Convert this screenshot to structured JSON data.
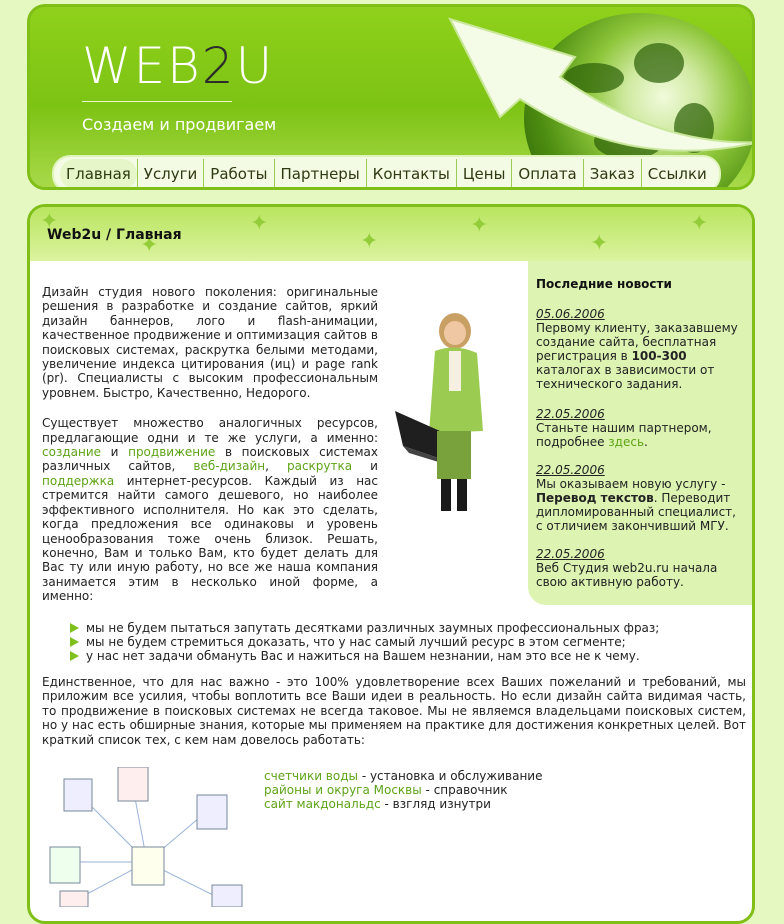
{
  "header": {
    "logo_left": "WEB",
    "logo_two": "2",
    "logo_right": "U",
    "slogan": "Создаем и продвигаем"
  },
  "nav": {
    "items": [
      "Главная",
      "Услуги",
      "Работы",
      "Партнеры",
      "Контакты",
      "Цены",
      "Оплата",
      "Заказ",
      "Ссылки"
    ],
    "active": 0
  },
  "breadcrumb": "Web2u / Главная",
  "intro": "Дизайн студия нового поколения: оригинальные решения в разработке и создание сайтов, яркий дизайн баннеров, лого и flash-анимации, качественное продвижение и оптимизация сайтов в поисковых системах, раскрутка белыми методами, увеличение индекса цитирования (иц) и page rank (pr). Специалисты с высоким профессиональным уровнем. Быстро, Качественно, Недорого.",
  "para2": {
    "before": "Существует множество аналогичных ресурсов, предлагающие одни и те же услуги, а именно: ",
    "link1": "создание",
    "and1": " и ",
    "link2": "продвижение",
    "mid": " в поисковых системах различных сайтов, ",
    "link3": "веб-дизайн",
    "comma": ", ",
    "link4": "раскрутка",
    "and2": " и ",
    "link5": "поддержка",
    "after": " интернет-ресурсов. Каждый из нас стремится найти самого дешевого, но наиболее эффективного исполнителя. Но как это сделать, когда предложения все одинаковы и уровень ценообразования тоже очень близок. Решать, конечно, Вам и только Вам, кто будет делать для Вас ту или иную работу, но все же наша компания занимается этим в несколько иной форме, а именно:"
  },
  "bullets": [
    "мы не будем пытаться запутать десятками различных заумных профессиональных фраз;",
    "мы не будем стремиться доказать, что у нас самый лучший ресурс в этом сегменте;",
    "у нас нет задачи обмануть Вас и нажиться на Вашем незнании, нам это все не к чему."
  ],
  "bottom_para": "Единственное, что для нас важно - это 100% удовлетворение всех Ваших пожеланий и требований, мы приложим все усилия, чтобы воплотить все Ваши идеи в реальность. Но если дизайн сайта видимая часть, то продвижение в поисковых системах не всегда таковое. Мы не являемся владельцами поисковых систем, но у нас есть обширные знания, которые мы применяем на практике для достижения конкретных целей. Вот краткий список тех, с кем нам довелось работать:",
  "clients": [
    {
      "link": "счетчики воды",
      "desc": " - установка и обслуживание"
    },
    {
      "link": "районы и округа Москвы",
      "desc": " - справочник"
    },
    {
      "link": "сайт макдональдс",
      "desc": " - взгляд изнутри"
    }
  ],
  "news": {
    "title": "Последние новости",
    "items": [
      {
        "date": "05.06.2006",
        "t1": "Первому клиенту, заказавшему создание сайта, бесплатная регистрация в ",
        "bold": "100-300",
        "t2": " каталогах в зависимости от технического задания."
      },
      {
        "date": "22.05.2006",
        "t1": "Станьте нашим партнером, подробнее ",
        "link": "здесь",
        "t2": "."
      },
      {
        "date": "22.05.2006",
        "t1": "Мы оказываем новую услугу - ",
        "bold": "Перевод текстов",
        "t2": ". Переводит дипломированный специалист, с отличием закончивший МГУ."
      },
      {
        "date": "22.05.2006",
        "t1": "Веб Студия web2u.ru начала свою активную работу."
      }
    ]
  },
  "colors": {
    "accent": "#7fbf17",
    "link": "#5ea317",
    "background": "#e6f8c2",
    "news_bg": "#ddf3b2"
  }
}
